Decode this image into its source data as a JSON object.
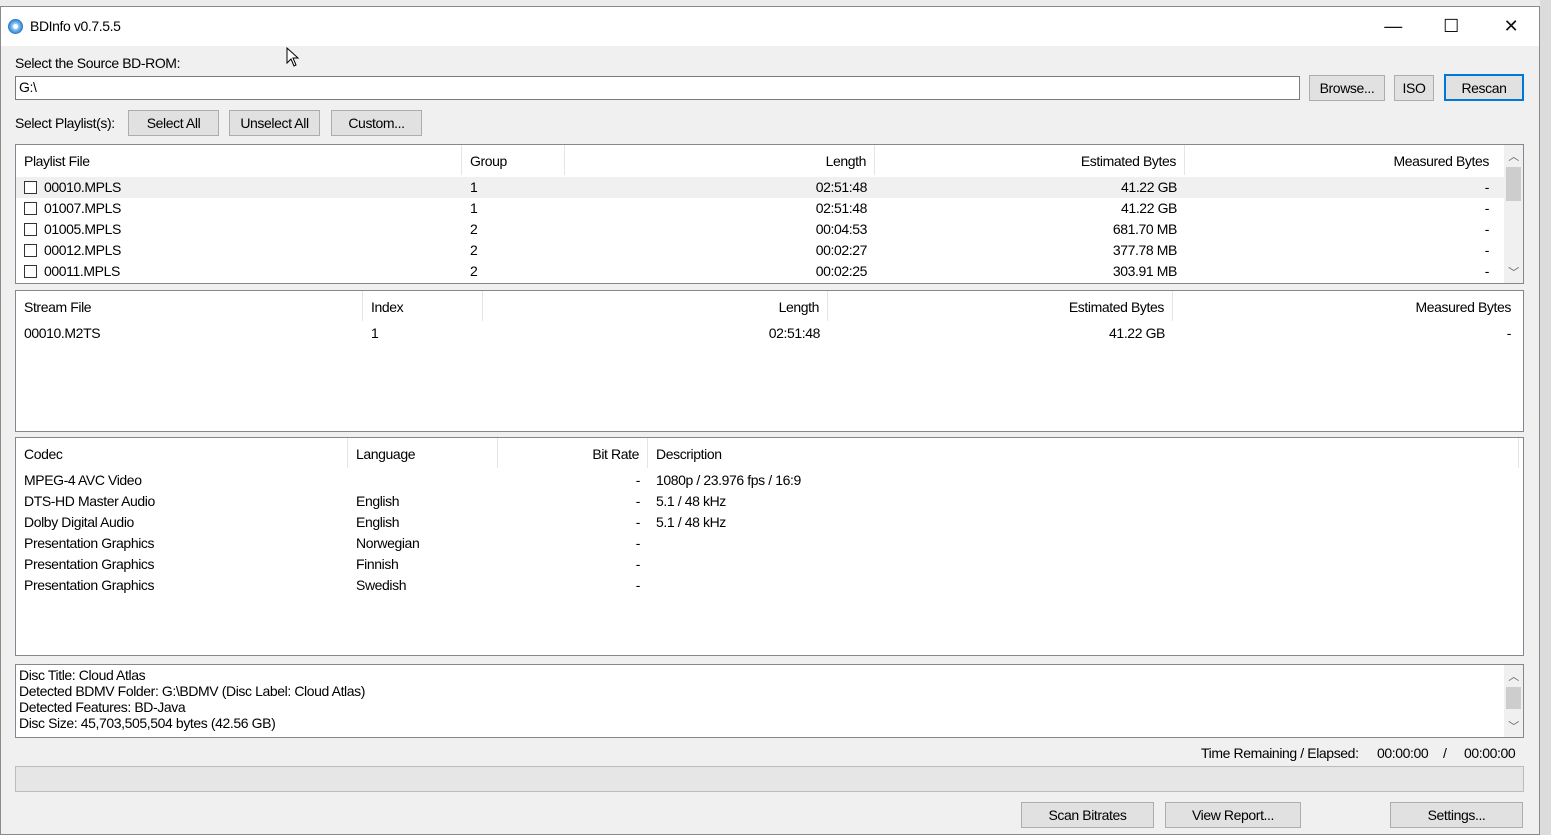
{
  "window": {
    "title": "BDInfo v0.7.5.5",
    "minimize_glyph": "—",
    "maximize_glyph": "☐",
    "close_glyph": "✕"
  },
  "source": {
    "label": "Select the Source BD-ROM:",
    "path_value": "G:\\",
    "browse_label": "Browse...",
    "iso_label": "ISO",
    "rescan_label": "Rescan"
  },
  "playlist_select": {
    "label": "Select Playlist(s):",
    "select_all_label": "Select All",
    "unselect_all_label": "Unselect All",
    "custom_label": "Custom..."
  },
  "playlists": {
    "headers": {
      "file": "Playlist File",
      "group": "Group",
      "length": "Length",
      "estimated": "Estimated Bytes",
      "measured": "Measured Bytes"
    },
    "rows": [
      {
        "file": "00010.MPLS",
        "group": "1",
        "length": "02:51:48",
        "estimated": "41.22 GB",
        "measured": "-",
        "checked": false
      },
      {
        "file": "01007.MPLS",
        "group": "1",
        "length": "02:51:48",
        "estimated": "41.22 GB",
        "measured": "-",
        "checked": false
      },
      {
        "file": "01005.MPLS",
        "group": "2",
        "length": "00:04:53",
        "estimated": "681.70 MB",
        "measured": "-",
        "checked": false
      },
      {
        "file": "00012.MPLS",
        "group": "2",
        "length": "00:02:27",
        "estimated": "377.78 MB",
        "measured": "-",
        "checked": false
      },
      {
        "file": "00011.MPLS",
        "group": "2",
        "length": "00:02:25",
        "estimated": "303.91 MB",
        "measured": "-",
        "checked": false
      }
    ]
  },
  "streams": {
    "headers": {
      "file": "Stream File",
      "index": "Index",
      "length": "Length",
      "estimated": "Estimated Bytes",
      "measured": "Measured Bytes"
    },
    "rows": [
      {
        "file": "00010.M2TS",
        "index": "1",
        "length": "02:51:48",
        "estimated": "41.22 GB",
        "measured": "-"
      }
    ]
  },
  "codecs": {
    "headers": {
      "codec": "Codec",
      "language": "Language",
      "bitrate": "Bit Rate",
      "description": "Description"
    },
    "rows": [
      {
        "codec": "MPEG-4 AVC Video",
        "language": "",
        "bitrate": "-",
        "description": "1080p / 23.976 fps / 16:9"
      },
      {
        "codec": "DTS-HD Master Audio",
        "language": "English",
        "bitrate": "-",
        "description": "5.1 / 48 kHz"
      },
      {
        "codec": "Dolby Digital Audio",
        "language": "English",
        "bitrate": "-",
        "description": "5.1 / 48 kHz"
      },
      {
        "codec": "Presentation Graphics",
        "language": "Norwegian",
        "bitrate": "-",
        "description": ""
      },
      {
        "codec": "Presentation Graphics",
        "language": "Finnish",
        "bitrate": "-",
        "description": ""
      },
      {
        "codec": "Presentation Graphics",
        "language": "Swedish",
        "bitrate": "-",
        "description": ""
      }
    ]
  },
  "disc_info": {
    "lines": [
      "Disc Title: Cloud Atlas",
      "Detected BDMV Folder: G:\\BDMV (Disc Label: Cloud Atlas)",
      "Detected Features: BD-Java",
      "Disc Size: 45,703,505,504 bytes (42.56 GB)"
    ]
  },
  "status": {
    "time_label": "Time Remaining / Elapsed:",
    "remaining": "00:00:00",
    "separator": "/",
    "elapsed": "00:00:00",
    "progress": 0
  },
  "actions": {
    "scan_label": "Scan Bitrates",
    "report_label": "View Report...",
    "settings_label": "Settings..."
  },
  "scroll": {
    "up_glyph": "︿",
    "down_glyph": "﹀"
  },
  "icons": {
    "app": "bd-disc-icon",
    "cursor": "mouse-pointer-icon"
  }
}
